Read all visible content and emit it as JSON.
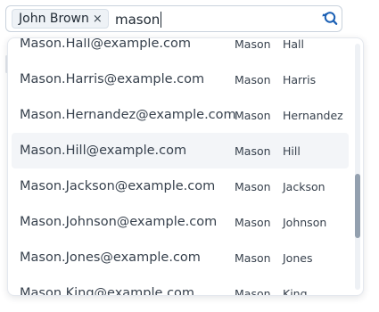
{
  "search": {
    "chip": {
      "label": "John Brown",
      "remove_icon": "close-icon",
      "remove_glyph": "×"
    },
    "query": "mason",
    "icon": "search-reset-icon",
    "icon_color": "#1a5fb4"
  },
  "results": [
    {
      "email": "Mason.Hall@example.com",
      "first_name": "Mason",
      "last_name": "Hall",
      "highlighted": false
    },
    {
      "email": "Mason.Harris@example.com",
      "first_name": "Mason",
      "last_name": "Harris",
      "highlighted": false
    },
    {
      "email": "Mason.Hernandez@example.com",
      "first_name": "Mason",
      "last_name": "Hernandez",
      "highlighted": false
    },
    {
      "email": "Mason.Hill@example.com",
      "first_name": "Mason",
      "last_name": "Hill",
      "highlighted": true
    },
    {
      "email": "Mason.Jackson@example.com",
      "first_name": "Mason",
      "last_name": "Jackson",
      "highlighted": false
    },
    {
      "email": "Mason.Johnson@example.com",
      "first_name": "Mason",
      "last_name": "Johnson",
      "highlighted": false
    },
    {
      "email": "Mason.Jones@example.com",
      "first_name": "Mason",
      "last_name": "Jones",
      "highlighted": false
    },
    {
      "email": "Mason.King@example.com",
      "first_name": "Mason",
      "last_name": "King",
      "highlighted": false
    }
  ],
  "colors": {
    "highlight_row": "#f3f5f8",
    "scroll_thumb": "#93a0af"
  }
}
